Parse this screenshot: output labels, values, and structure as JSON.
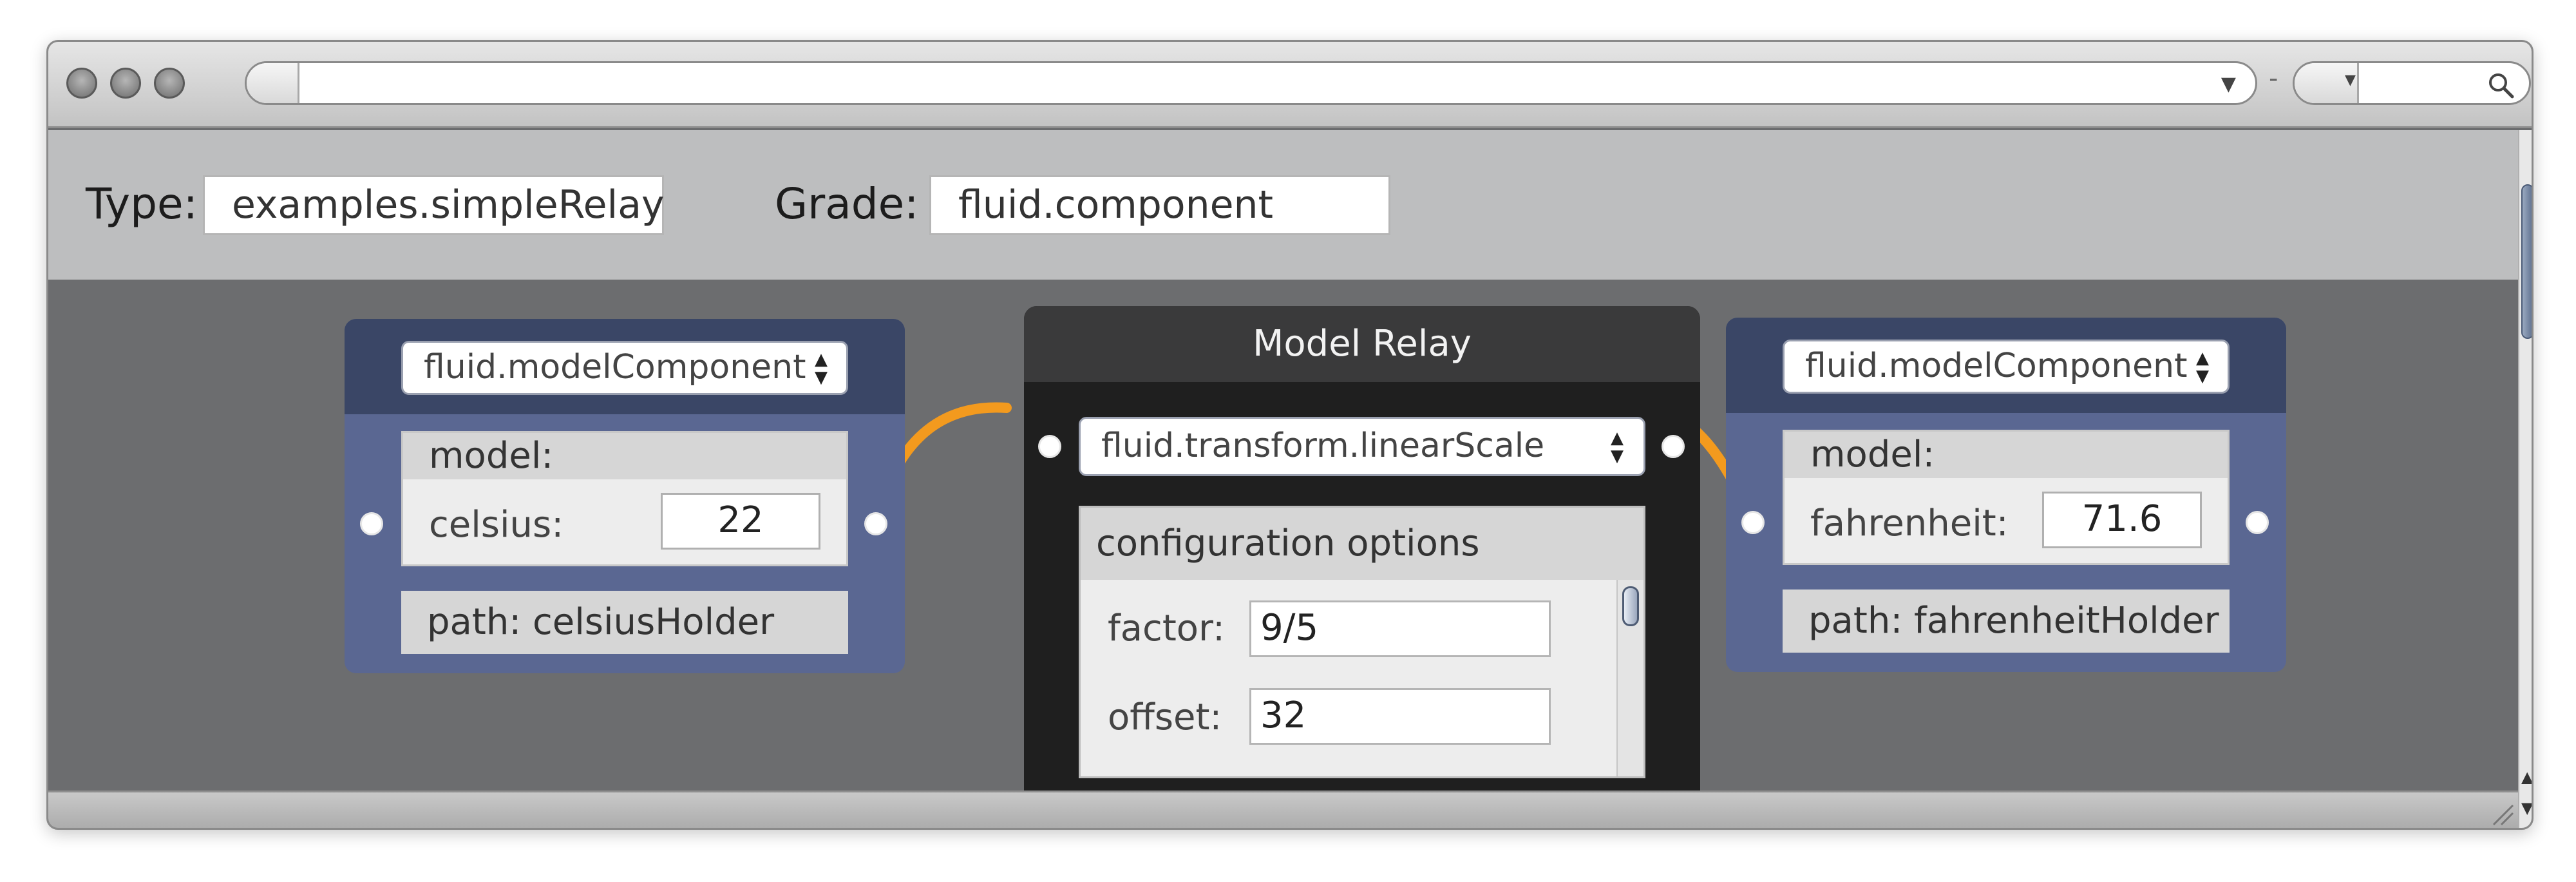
{
  "browser": {
    "address_value": "",
    "search_value": "",
    "separator": "-"
  },
  "form": {
    "type_label": "Type:",
    "type_value": "examples.simpleRelay",
    "grade_label": "Grade:",
    "grade_value": "fluid.component"
  },
  "left_component": {
    "grade_select": "fluid.modelComponent",
    "model_heading": "model:",
    "field_label": "celsius:",
    "field_value": "22",
    "path": "path: celsiusHolder"
  },
  "relay": {
    "title": "Model Relay",
    "transform_select": "fluid.transform.linearScale",
    "config_heading": "configuration options",
    "factor_label": "factor:",
    "factor_value": "9/5",
    "offset_label": "offset:",
    "offset_value": "32"
  },
  "right_component": {
    "grade_select": "fluid.modelComponent",
    "model_heading": "model:",
    "field_label": "fahrenheit:",
    "field_value": "71.6",
    "path": "path: fahrenheitHolder"
  },
  "icons": {
    "dropdown": "chevron-down-icon",
    "search": "magnifier-icon",
    "spinner": "up-down-arrows-icon",
    "resize": "resize-grip-icon"
  },
  "colors": {
    "connector": "#f39a1e",
    "panel": "#5a6792",
    "panel_header": "#3a4666",
    "relay": "#1f1f1f",
    "relay_header": "#3a3a3b",
    "canvas": "#6c6d6f"
  }
}
